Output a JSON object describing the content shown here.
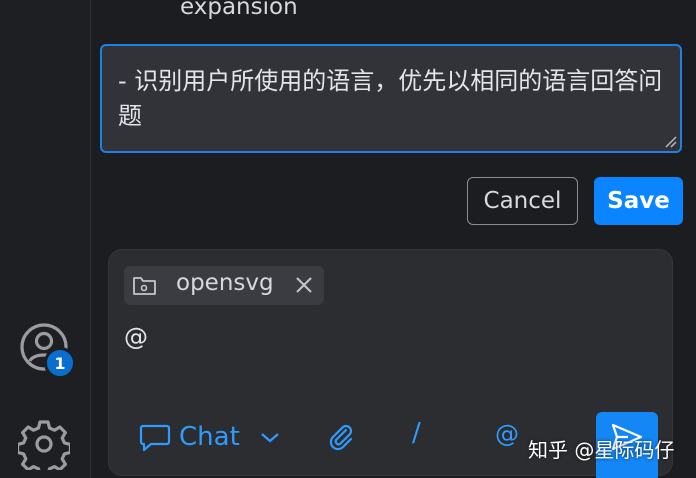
{
  "previous_item": {
    "text": "expansion"
  },
  "editor": {
    "value": "- 识别用户所使用的语言，优先以相同的语言回答问题"
  },
  "actions": {
    "cancel_label": "Cancel",
    "save_label": "Save"
  },
  "account": {
    "badge_count": "1"
  },
  "chat_input": {
    "context_chip": {
      "label": "opensvg"
    },
    "value": "@",
    "mode_label": "Chat",
    "slash_label": "/",
    "mention_label": "@"
  },
  "watermark": {
    "text": "知乎 @星际码仔"
  },
  "colors": {
    "accent": "#0a84ff",
    "link": "#2f9bff",
    "editor_border": "#1b81e5",
    "background": "#1e1f22"
  },
  "icons": [
    "account-icon",
    "gear-icon",
    "folder-icon",
    "close-icon",
    "chat-bubble-icon",
    "chevron-down-icon",
    "paperclip-icon",
    "send-icon",
    "resize-handle-icon"
  ]
}
